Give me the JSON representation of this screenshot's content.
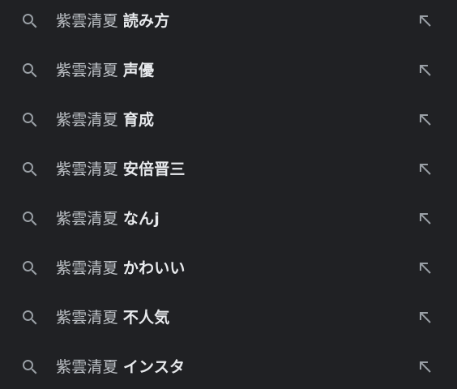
{
  "suggestions": [
    {
      "query": "紫雲清夏",
      "suggestion": "読み方"
    },
    {
      "query": "紫雲清夏",
      "suggestion": "声優"
    },
    {
      "query": "紫雲清夏",
      "suggestion": "育成"
    },
    {
      "query": "紫雲清夏",
      "suggestion": "安倍晋三"
    },
    {
      "query": "紫雲清夏",
      "suggestion": "なんj"
    },
    {
      "query": "紫雲清夏",
      "suggestion": "かわいい"
    },
    {
      "query": "紫雲清夏",
      "suggestion": "不人気"
    },
    {
      "query": "紫雲清夏",
      "suggestion": "インスタ"
    }
  ],
  "icons": {
    "leading": "search-icon",
    "trailing": "arrow-up-left-icon"
  },
  "colors": {
    "background": "#202124",
    "text": "#bdc1c6",
    "icon": "#9aa0a6"
  }
}
